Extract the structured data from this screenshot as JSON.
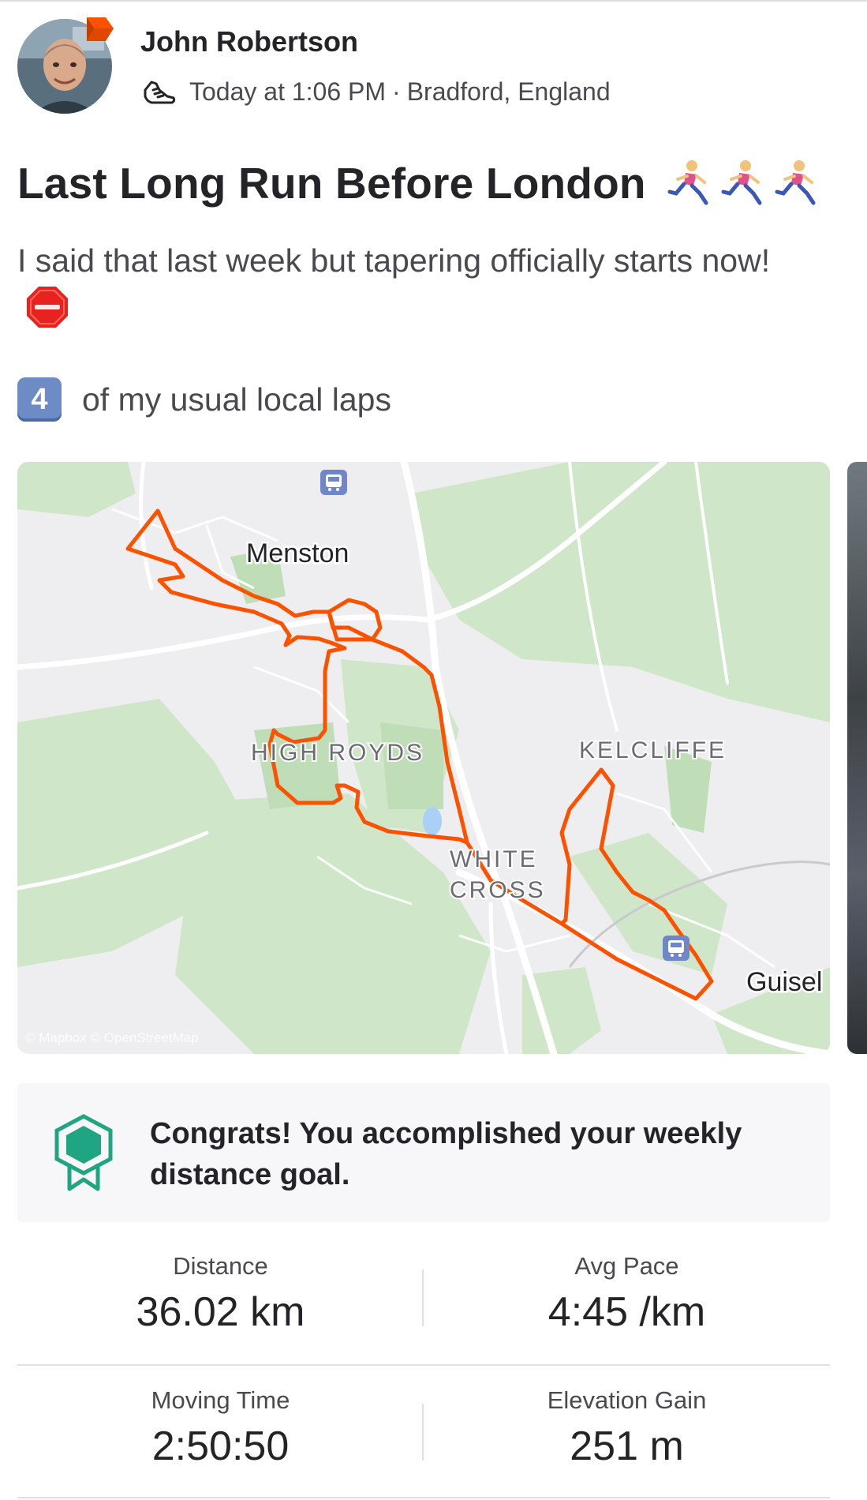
{
  "athlete": {
    "name": "John Robertson",
    "timestamp": "Today at 1:06 PM",
    "separator": "·",
    "location": "Bradford, England"
  },
  "activity": {
    "title": "Last Long Run Before London",
    "description_line1": "I said that last week but tapering officially starts now!",
    "laps_number": "4",
    "description_line2": "of my usual local laps"
  },
  "map": {
    "labels": {
      "menston": "Menston",
      "high_royds": "HIGH ROYDS",
      "kelcliffe": "KELCLIFFE",
      "white_cross_1": "WHITE",
      "white_cross_2": "CROSS",
      "guiseley": "Guisel"
    },
    "attribution": "© Mapbox © OpenStreetMap",
    "route_color": "#fc5200"
  },
  "goal": {
    "message": "Congrats! You accomplished your weekly distance goal."
  },
  "stats": [
    {
      "label": "Distance",
      "value": "36.02 km"
    },
    {
      "label": "Avg Pace",
      "value": "4:45 /km"
    },
    {
      "label": "Moving Time",
      "value": "2:50:50"
    },
    {
      "label": "Elevation Gain",
      "value": "251 m"
    }
  ],
  "colors": {
    "brand_orange": "#fc5200",
    "goal_green": "#1fa582"
  }
}
